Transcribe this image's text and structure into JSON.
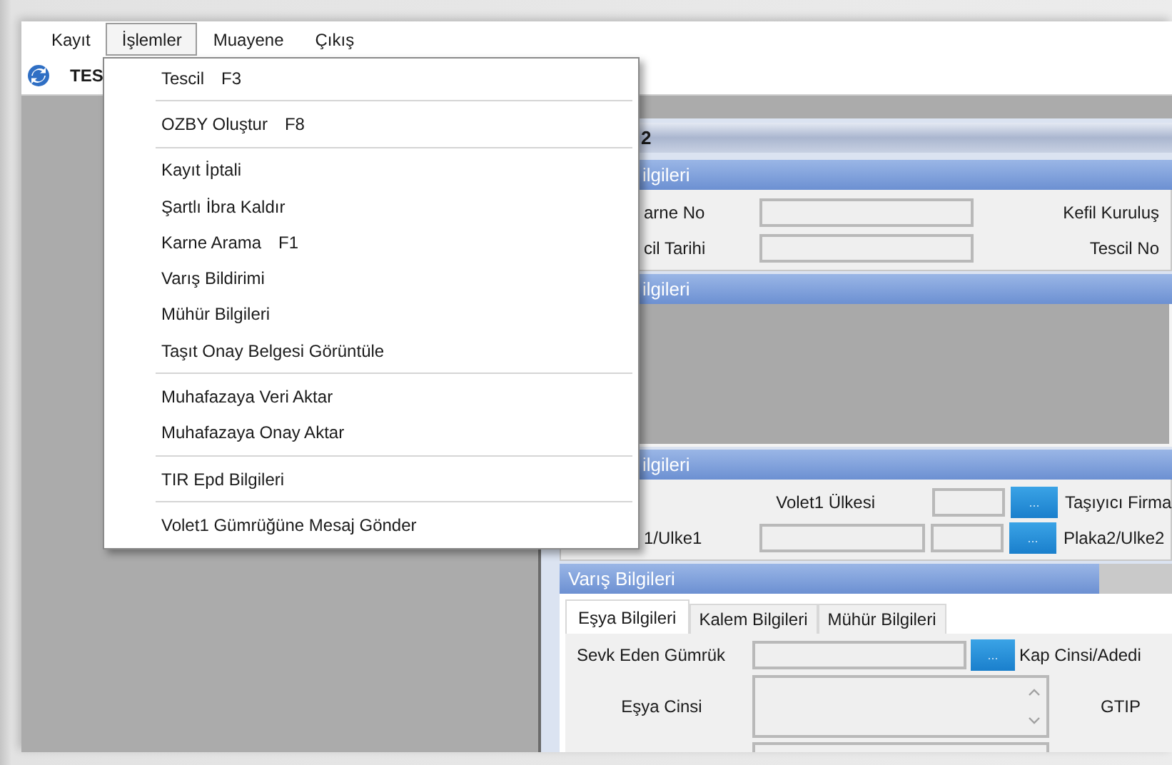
{
  "menubar": [
    {
      "label": "Kayıt",
      "selected": false
    },
    {
      "label": "İşlemler",
      "selected": true
    },
    {
      "label": "Muayene",
      "selected": false
    },
    {
      "label": "Çıkış",
      "selected": false
    }
  ],
  "toolbar": {
    "title": "TES"
  },
  "menu": {
    "groups": [
      [
        {
          "label": "Tescil",
          "shortcut": "F3"
        }
      ],
      [
        {
          "label": "OZBY Oluştur",
          "shortcut": "F8"
        }
      ],
      [
        {
          "label": "Kayıt İptali"
        },
        {
          "label": "Şartlı İbra Kaldır"
        },
        {
          "label": "Karne Arama",
          "shortcut": "F1"
        },
        {
          "label": "Varış Bildirimi"
        },
        {
          "label": "Mühür Bilgileri"
        },
        {
          "label": "Taşıt Onay Belgesi Görüntüle"
        }
      ],
      [
        {
          "label": "Muhafazaya Veri Aktar"
        },
        {
          "label": "Muhafazaya Onay Aktar"
        }
      ],
      [
        {
          "label": "TIR Epd Bilgileri"
        }
      ],
      [
        {
          "label": "Volet1 Gümrüğüne Mesaj Gönder"
        }
      ]
    ]
  },
  "child_window": {
    "title": "2",
    "sections": [
      {
        "kind": "fields",
        "header": "ilgileri",
        "rows": [
          {
            "kind": "field",
            "label": "arne No",
            "end_label": "Kefil Kuruluş"
          },
          {
            "kind": "field",
            "label": "cil Tarihi",
            "end_label": "Tescil No"
          }
        ]
      },
      {
        "kind": "blank",
        "header": "ilgileri"
      },
      {
        "kind": "fields",
        "header": "ilgileri",
        "rows": [
          {
            "kind": "country",
            "label": "Volet1 Ülkesi",
            "button": "...",
            "end_label": "Taşıyıcı Firma"
          },
          {
            "kind": "plate",
            "label": "1/Ulke1",
            "button": "...",
            "end_label": "Plaka2/Ulke2"
          }
        ]
      },
      {
        "kind": "tabbed",
        "header": "Varış Bilgileri",
        "tabs": [
          {
            "label": "Eşya Bilgileri",
            "selected": true
          },
          {
            "label": "Kalem Bilgileri",
            "selected": false
          },
          {
            "label": "Mühür Bilgileri",
            "selected": false
          }
        ],
        "rows": [
          {
            "kind": "lookup",
            "label": "Sevk Eden Gümrük",
            "button": "...",
            "end_label": "Kap Cinsi/Adedi"
          },
          {
            "kind": "memo",
            "label": "Eşya Cinsi",
            "end_label": "GTIP"
          },
          {
            "kind": "memo_cut"
          }
        ]
      }
    ]
  }
}
